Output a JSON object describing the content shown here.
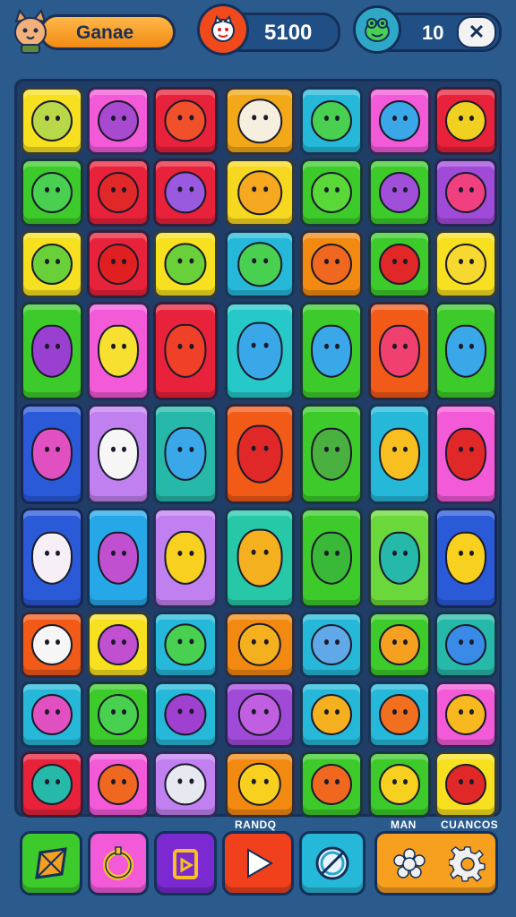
{
  "header": {
    "title": "Ganae",
    "score": "5100",
    "lives": "10",
    "close_symbol": "✕"
  },
  "colors": {
    "background": "#2b5a8c",
    "board": "#1f3d66",
    "accent_orange": "#f28a12",
    "play_red": "#f0401c"
  },
  "board": {
    "rows": [
      {
        "tiles": [
          {
            "color": "#f7e020",
            "icon": "cone-hat-creature-icon",
            "c": "#b8d84a"
          },
          {
            "color": "#f25ad8",
            "icon": "purple-blob-icon",
            "c": "#a84ad0"
          },
          {
            "color": "#e8223a",
            "icon": "shell-icon",
            "c": "#f0502a"
          },
          {
            "color": "#f2a818",
            "icon": "ghost-hood-icon",
            "c": "#f6efe0"
          },
          {
            "color": "#26b8d8",
            "icon": "green-frog-icon",
            "c": "#4ad050"
          },
          {
            "color": "#f25ad8",
            "icon": "blue-bird-icon",
            "c": "#3aa8e8"
          },
          {
            "color": "#e8223a",
            "icon": "yellow-fish-icon",
            "c": "#f0d020"
          }
        ]
      },
      {
        "tiles": [
          {
            "color": "#3ccb2a",
            "icon": "green-cat-icon",
            "c": "#4ad050"
          },
          {
            "color": "#e8223a",
            "icon": "red-horned-icon",
            "c": "#e02828"
          },
          {
            "color": "#e8223a",
            "icon": "purple-diamond-icon",
            "c": "#9a5ae0"
          },
          {
            "color": "#f7d820",
            "icon": "orange-cat-icon",
            "c": "#f5a820"
          },
          {
            "color": "#3ccb2a",
            "icon": "leaf-icon",
            "c": "#5ad83a"
          },
          {
            "color": "#3ccb2a",
            "icon": "purple-bird-icon",
            "c": "#a050d8"
          },
          {
            "color": "#a04ad8",
            "icon": "pink-blob-icon",
            "c": "#f04080"
          }
        ]
      },
      {
        "tiles": [
          {
            "color": "#f7e020",
            "icon": "green-apple-icon",
            "c": "#6ad03a"
          },
          {
            "color": "#e8223a",
            "icon": "red-shield-icon",
            "c": "#e02020"
          },
          {
            "color": "#f7e020",
            "icon": "green-cat-icon",
            "c": "#6ad03a"
          },
          {
            "color": "#26b8d8",
            "icon": "green-gem-icon",
            "c": "#4ad050"
          },
          {
            "color": "#f28a12",
            "icon": "sun-icon",
            "c": "#f06820"
          },
          {
            "color": "#3ccb2a",
            "icon": "red-apple-icon",
            "c": "#e02828"
          },
          {
            "color": "#f7e020",
            "icon": "sun-creature-icon",
            "c": "#f7d830"
          }
        ]
      },
      {
        "tiles": [
          {
            "color": "#3ccb2a",
            "icon": "purple-blob-icon",
            "c": "#9a40d0"
          },
          {
            "color": "#f25ad8",
            "icon": "lemon-icon",
            "c": "#f7e030"
          },
          {
            "color": "#e8223a",
            "icon": "red-drop-icon",
            "c": "#f04028"
          },
          {
            "color": "#26c8c8",
            "icon": "blue-puffer-icon",
            "c": "#3aa8e8"
          },
          {
            "color": "#3ccb2a",
            "icon": "blue-cone-icon",
            "c": "#3aa8e8"
          },
          {
            "color": "#f25a18",
            "icon": "pink-balloon-icon",
            "c": "#f04070"
          },
          {
            "color": "#3ccb2a",
            "icon": "blue-cone-icon",
            "c": "#3aa8e8"
          }
        ]
      },
      {
        "tiles": [
          {
            "color": "#2a5ad8",
            "icon": "ice-cream-cone-icon",
            "c": "#e050c0"
          },
          {
            "color": "#c080f0",
            "icon": "white-ghost-icon",
            "c": "#f6f6f6"
          },
          {
            "color": "#26b8a8",
            "icon": "blue-drop-icon",
            "c": "#3aa8e8"
          },
          {
            "color": "#f25a18",
            "icon": "red-cat-icon",
            "c": "#e02828"
          },
          {
            "color": "#3ccb2a",
            "icon": "green-fish-icon",
            "c": "#4ab040"
          },
          {
            "color": "#26b8d8",
            "icon": "yellow-bird-icon",
            "c": "#f7c020"
          },
          {
            "color": "#f25ad8",
            "icon": "red-pepper-icon",
            "c": "#e02828"
          }
        ]
      },
      {
        "tiles": [
          {
            "color": "#2a5ad8",
            "icon": "white-cat-icon",
            "c": "#f6f0f6"
          },
          {
            "color": "#26a8e8",
            "icon": "purple-wizard-icon",
            "c": "#c050d0"
          },
          {
            "color": "#c080f0",
            "icon": "yellow-cat-icon",
            "c": "#f7d020"
          },
          {
            "color": "#26c8a8",
            "icon": "orange-fish-icon",
            "c": "#f5b020"
          },
          {
            "color": "#3ccb2a",
            "icon": "plant-icon",
            "c": "#3ab838"
          },
          {
            "color": "#6ad83a",
            "icon": "teal-leaf-icon",
            "c": "#26b8a8"
          },
          {
            "color": "#2a5ad8",
            "icon": "yellow-lemon-icon",
            "c": "#f7d020"
          }
        ]
      },
      {
        "tiles": [
          {
            "color": "#f25a18",
            "icon": "white-ghost-icon",
            "c": "#f6f6f6"
          },
          {
            "color": "#f7e020",
            "icon": "purple-sun-icon",
            "c": "#c050d0"
          },
          {
            "color": "#26b8d8",
            "icon": "green-frog-icon",
            "c": "#4ad050"
          },
          {
            "color": "#f28a12",
            "icon": "orange-cat-icon",
            "c": "#f5b020"
          },
          {
            "color": "#26b8d8",
            "icon": "blue-cat-icon",
            "c": "#60a8e8"
          },
          {
            "color": "#3ccb2a",
            "icon": "orange-candy-icon",
            "c": "#f5a020"
          },
          {
            "color": "#26b8a8",
            "icon": "blue-planet-icon",
            "c": "#3a8ae8"
          }
        ]
      },
      {
        "tiles": [
          {
            "color": "#26b8d8",
            "icon": "pink-shell-icon",
            "c": "#e050c0"
          },
          {
            "color": "#3ccb2a",
            "icon": "green-frog-icon",
            "c": "#4ad050"
          },
          {
            "color": "#26b8d8",
            "icon": "purple-cone-icon",
            "c": "#a040d0"
          },
          {
            "color": "#a04ad8",
            "icon": "purple-shell-icon",
            "c": "#c060e0"
          },
          {
            "color": "#26b8d8",
            "icon": "orange-bird-icon",
            "c": "#f5b020"
          },
          {
            "color": "#26b8d8",
            "icon": "orange-cone-icon",
            "c": "#f07020"
          },
          {
            "color": "#f25ad8",
            "icon": "orange-fruit-icon",
            "c": "#f7b820"
          }
        ]
      },
      {
        "tiles": [
          {
            "color": "#e8223a",
            "icon": "teal-cat-icon",
            "c": "#26b8a8"
          },
          {
            "color": "#f25ad8",
            "icon": "orange-star-icon",
            "c": "#f06820"
          },
          {
            "color": "#c080f0",
            "icon": "paper-icon",
            "c": "#e8e8f0"
          },
          {
            "color": "#f28a12",
            "icon": "yellow-cat-icon",
            "c": "#f7d020"
          },
          {
            "color": "#3ccb2a",
            "icon": "orange-bear-icon",
            "c": "#f06820"
          },
          {
            "color": "#3ccb2a",
            "icon": "yellow-fish-icon",
            "c": "#f7d020"
          },
          {
            "color": "#f7e020",
            "icon": "red-blob-icon",
            "c": "#e02828"
          }
        ]
      }
    ]
  },
  "bottom": {
    "label_left": "RANDQ",
    "label_mid": "MAN",
    "label_right": "CUANCOS",
    "buttons": [
      {
        "name": "kite-button",
        "color": "#3ccb2a"
      },
      {
        "name": "ring-button",
        "color": "#f25ad8"
      },
      {
        "name": "box-button",
        "color": "#8a3ad8"
      },
      {
        "name": "play-button",
        "color": "#f0401c"
      },
      {
        "name": "compass-button",
        "color": "#26b8d8"
      },
      {
        "name": "settings-button",
        "color": "#f7a020"
      }
    ]
  }
}
